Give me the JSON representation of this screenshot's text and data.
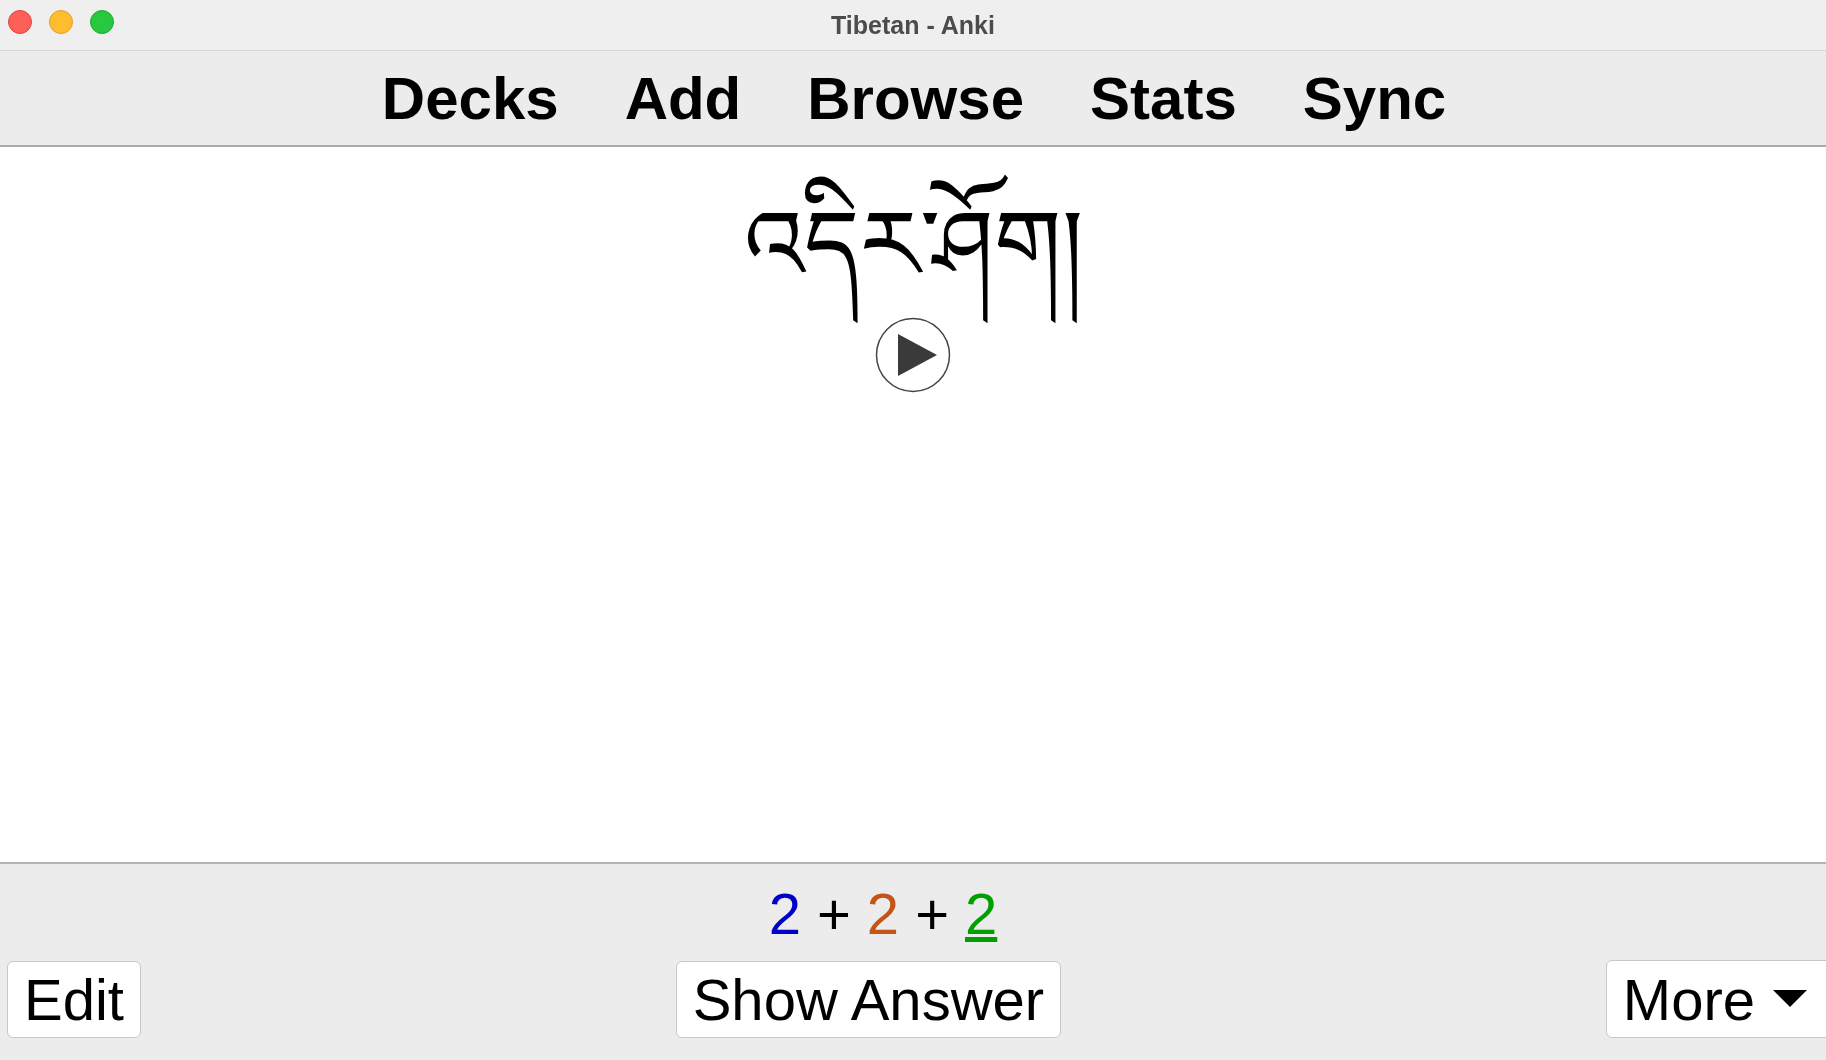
{
  "window": {
    "title": "Tibetan - Anki"
  },
  "toolbar": [
    "Decks",
    "Add",
    "Browse",
    "Stats",
    "Sync"
  ],
  "card": {
    "front": "འདིར་ཤོག།"
  },
  "counts": {
    "separator": "+",
    "items": [
      {
        "text": "2",
        "color": "#0000c8",
        "selected": false
      },
      {
        "text": "2",
        "color": "#c35617",
        "selected": false
      },
      {
        "text": "2",
        "color": "#00a000",
        "selected": true
      }
    ]
  },
  "buttons": {
    "edit": "Edit",
    "show_answer": "Show Answer",
    "more": "More"
  }
}
